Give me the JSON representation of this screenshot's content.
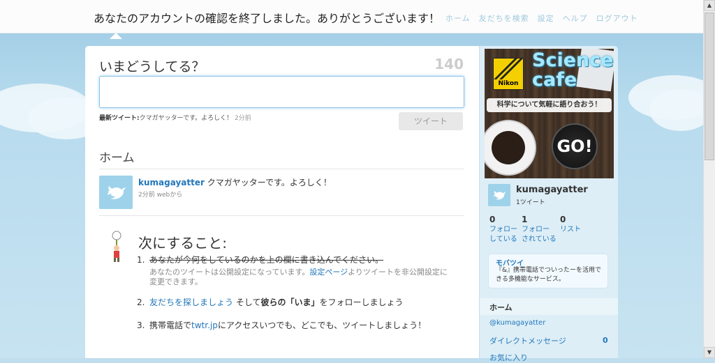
{
  "notice": {
    "message": "あなたのアカウントの確認を終了しました。ありがとうございます！",
    "topnav": "ホーム　友だちを検索　設定　ヘルプ　ログアウト"
  },
  "composer": {
    "prompt": "いまどうしてる？",
    "char_counter": "140",
    "latest_label": "最新ツイート:",
    "latest_text": "クマガヤッターです。よろしく！",
    "latest_time": "2分前",
    "tweet_button": "ツイート"
  },
  "timeline": {
    "heading": "ホーム",
    "tweets": [
      {
        "username": "kumagayatter",
        "text": "クマガヤッターです。よろしく！",
        "meta": "2分前 webから"
      }
    ]
  },
  "next_steps": {
    "heading": "次にすること:",
    "step1_num": "1.",
    "step1_text": "あなたが今何をしているのかを上の欄に書き込んでください。",
    "step1_note_a": "あなたのツイートは公開設定になっています。",
    "step1_note_link": "設定ページ",
    "step1_note_b": "よりツイートを非公開設定に変更できます。",
    "step2_num": "2.",
    "step2_link": "友だちを探しましょう",
    "step2_mid": " そして",
    "step2_bold": "彼らの「いま」",
    "step2_end": "をフォローしましょう",
    "step3_num": "3.",
    "step3_a": "携帯電話で",
    "step3_link": "twtr.jp",
    "step3_b": "にアクセスいつでも、どこでも、ツイートしましょう！"
  },
  "ad": {
    "brand": "Nikon",
    "title_line1": "Science",
    "title_line2": "cafe",
    "caption": "科学について気軽に語り合おう！",
    "cta": "GO!"
  },
  "profile": {
    "username": "kumagayatter",
    "tweet_count": "1ツイート",
    "stats": [
      {
        "value": "0",
        "label1": "フォロー",
        "label2": "している"
      },
      {
        "value": "1",
        "label1": "フォロー",
        "label2": "されている"
      },
      {
        "value": "0",
        "label1": "リスト",
        "label2": ""
      }
    ]
  },
  "mobile": {
    "title": "モバツイ",
    "description": "『&』携帯電話でついったーを活用できる多機能なサービス。"
  },
  "sidebar_nav": {
    "home": "ホーム",
    "mention": "@kumagayatter",
    "dm": "ダイレクトメッセージ",
    "dm_count": "0",
    "favorites": "お気に入り"
  }
}
